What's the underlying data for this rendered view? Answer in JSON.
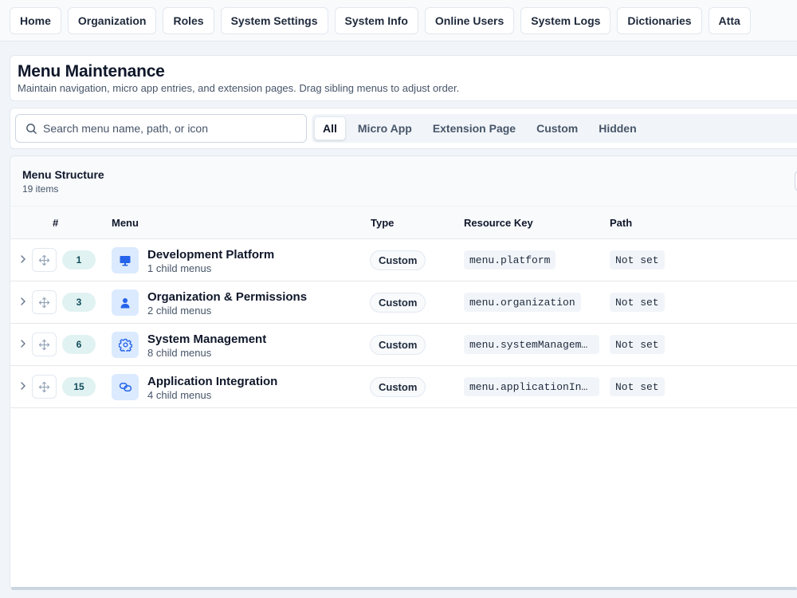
{
  "tabs": [
    {
      "label": "Home",
      "name": "tab-home"
    },
    {
      "label": "Organization",
      "name": "tab-organization"
    },
    {
      "label": "Roles",
      "name": "tab-roles"
    },
    {
      "label": "System Settings",
      "name": "tab-system-settings"
    },
    {
      "label": "System Info",
      "name": "tab-system-info"
    },
    {
      "label": "Online Users",
      "name": "tab-online-users"
    },
    {
      "label": "System Logs",
      "name": "tab-system-logs"
    },
    {
      "label": "Dictionaries",
      "name": "tab-dictionaries"
    },
    {
      "label": "Atta",
      "name": "tab-attachments"
    }
  ],
  "header": {
    "title": "Menu Maintenance",
    "subtitle": "Maintain navigation, micro app entries, and extension pages. Drag sibling menus to adjust order."
  },
  "search": {
    "placeholder": "Search menu name, path, or icon",
    "value": "",
    "icon": "search-icon"
  },
  "filters": {
    "items": [
      "All",
      "Micro App",
      "Extension Page",
      "Custom",
      "Hidden"
    ],
    "active": "All"
  },
  "table": {
    "title": "Menu Structure",
    "count": "19 items",
    "columns": {
      "order": "#",
      "menu": "Menu",
      "type": "Type",
      "resource_key": "Resource Key",
      "path": "Path"
    },
    "rows": [
      {
        "order": "1",
        "name": "Development Platform",
        "children": "1 child menus",
        "type": "Custom",
        "resource_key": "menu.platform",
        "path": "Not set",
        "icon": "monitor-icon"
      },
      {
        "order": "3",
        "name": "Organization & Permissions",
        "children": "2 child menus",
        "type": "Custom",
        "resource_key": "menu.organization",
        "path": "Not set",
        "icon": "user-icon"
      },
      {
        "order": "6",
        "name": "System Management",
        "children": "8 child menus",
        "type": "Custom",
        "resource_key": "menu.systemManagement",
        "path": "Not set",
        "icon": "gear-icon"
      },
      {
        "order": "15",
        "name": "Application Integration",
        "children": "4 child menus",
        "type": "Custom",
        "resource_key": "menu.applicationInte…",
        "path": "Not set",
        "icon": "link-icon"
      }
    ]
  },
  "colors": {
    "accent": "#2563eb",
    "icon_bg": "#dbeafe",
    "order_badge_bg": "#e0f2f1",
    "order_badge_text": "#0f4c5c"
  }
}
